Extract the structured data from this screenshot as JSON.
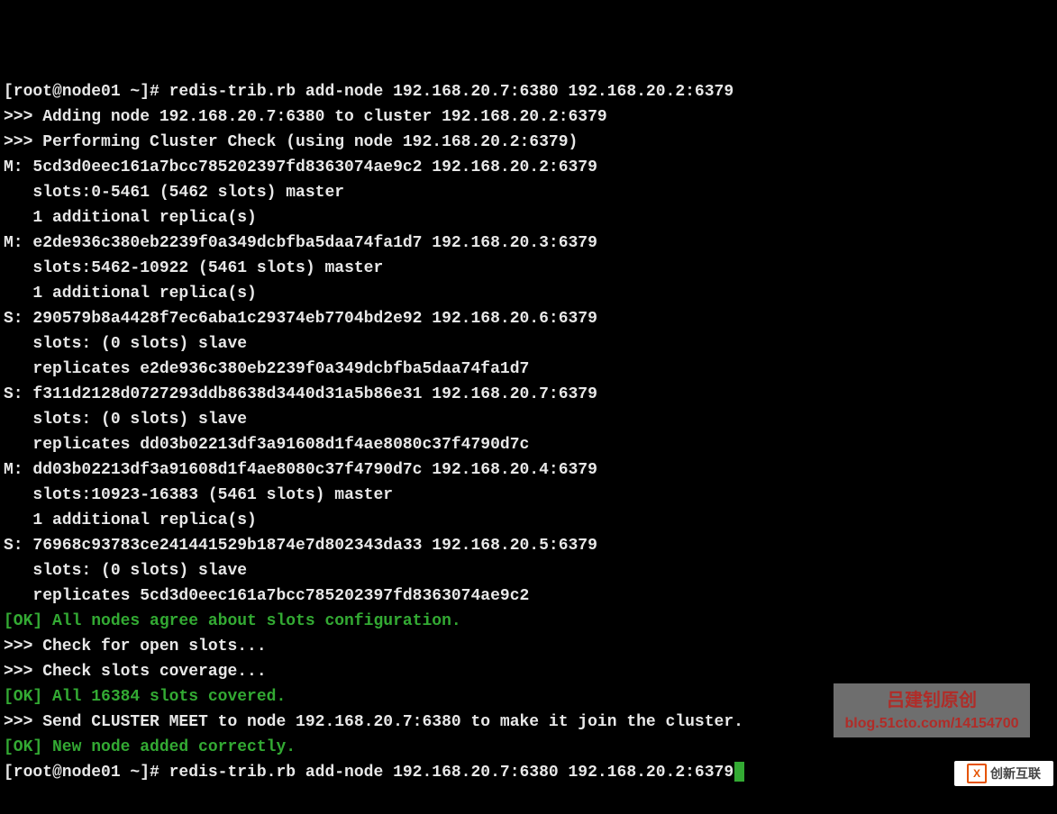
{
  "lines": [
    {
      "color": "white",
      "text": "[root@node01 ~]# redis-trib.rb add-node 192.168.20.7:6380 192.168.20.2:6379"
    },
    {
      "color": "white",
      "text": ">>> Adding node 192.168.20.7:6380 to cluster 192.168.20.2:6379"
    },
    {
      "color": "white",
      "text": ">>> Performing Cluster Check (using node 192.168.20.2:6379)"
    },
    {
      "color": "white",
      "text": "M: 5cd3d0eec161a7bcc785202397fd8363074ae9c2 192.168.20.2:6379"
    },
    {
      "color": "white",
      "text": "   slots:0-5461 (5462 slots) master"
    },
    {
      "color": "white",
      "text": "   1 additional replica(s)"
    },
    {
      "color": "white",
      "text": "M: e2de936c380eb2239f0a349dcbfba5daa74fa1d7 192.168.20.3:6379"
    },
    {
      "color": "white",
      "text": "   slots:5462-10922 (5461 slots) master"
    },
    {
      "color": "white",
      "text": "   1 additional replica(s)"
    },
    {
      "color": "white",
      "text": "S: 290579b8a4428f7ec6aba1c29374eb7704bd2e92 192.168.20.6:6379"
    },
    {
      "color": "white",
      "text": "   slots: (0 slots) slave"
    },
    {
      "color": "white",
      "text": "   replicates e2de936c380eb2239f0a349dcbfba5daa74fa1d7"
    },
    {
      "color": "white",
      "text": "S: f311d2128d0727293ddb8638d3440d31a5b86e31 192.168.20.7:6379"
    },
    {
      "color": "white",
      "text": "   slots: (0 slots) slave"
    },
    {
      "color": "white",
      "text": "   replicates dd03b02213df3a91608d1f4ae8080c37f4790d7c"
    },
    {
      "color": "white",
      "text": "M: dd03b02213df3a91608d1f4ae8080c37f4790d7c 192.168.20.4:6379"
    },
    {
      "color": "white",
      "text": "   slots:10923-16383 (5461 slots) master"
    },
    {
      "color": "white",
      "text": "   1 additional replica(s)"
    },
    {
      "color": "white",
      "text": "S: 76968c93783ce241441529b1874e7d802343da33 192.168.20.5:6379"
    },
    {
      "color": "white",
      "text": "   slots: (0 slots) slave"
    },
    {
      "color": "white",
      "text": "   replicates 5cd3d0eec161a7bcc785202397fd8363074ae9c2"
    },
    {
      "color": "green",
      "text": "[OK] All nodes agree about slots configuration."
    },
    {
      "color": "white",
      "text": ">>> Check for open slots..."
    },
    {
      "color": "white",
      "text": ">>> Check slots coverage..."
    },
    {
      "color": "green",
      "text": "[OK] All 16384 slots covered."
    },
    {
      "color": "white",
      "text": ">>> Send CLUSTER MEET to node 192.168.20.7:6380 to make it join the cluster."
    },
    {
      "color": "green",
      "text": "[OK] New node added correctly."
    }
  ],
  "prompt": {
    "text": "[root@node01 ~]# redis-trib.rb add-node 192.168.20.7:6380 192.168.20.2:6379"
  },
  "watermark": {
    "title": "吕建钊原创",
    "url": "blog.51cto.com/14154700"
  },
  "logo": {
    "mark": "X",
    "text": "创新互联"
  }
}
